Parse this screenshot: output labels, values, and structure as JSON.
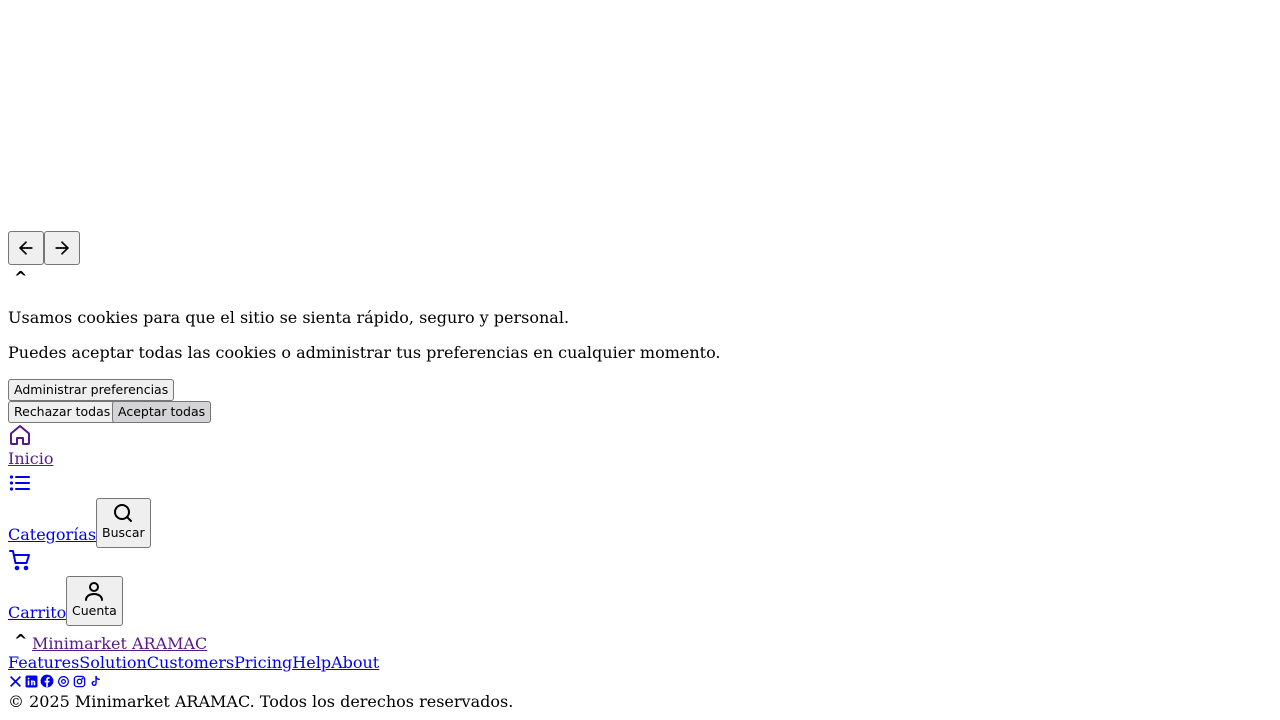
{
  "carousel": {
    "prev_icon": "arrow-left-icon",
    "next_icon": "arrow-right-icon"
  },
  "cookie_banner": {
    "toggle_glyph": "^",
    "message_1": "Usamos cookies para que el sitio se sienta rápido, seguro y personal.",
    "message_2": "Puedes aceptar todas las cookies o administrar tus preferencias en cualquier momento.",
    "manage_label": "Administrar preferencias",
    "reject_label": "Rechazar todas",
    "accept_label": "Aceptar todas"
  },
  "bottom_nav": {
    "home_label": "Inicio",
    "home_icon": "home-icon",
    "categories_label": "Categorías",
    "categories_icon": "list-icon",
    "search_label": "Buscar",
    "search_icon": "search-icon",
    "cart_label": "Carrito",
    "cart_icon": "cart-icon",
    "account_label": "Cuenta",
    "account_icon": "user-icon"
  },
  "footer": {
    "toggle_glyph": "^",
    "brand": "Minimarket ARAMAC",
    "links": [
      "Features",
      "Solution",
      "Customers",
      "Pricing",
      "Help",
      "About"
    ],
    "social_icons": [
      "x-icon",
      "linkedin-icon",
      "facebook-icon",
      "threads-icon",
      "instagram-icon",
      "tiktok-icon"
    ],
    "copyright": "© 2025 Minimarket ARAMAC. Todos los derechos reservados."
  },
  "colors": {
    "visited_link": "#551a8b",
    "link": "#0000ee",
    "button_bg": "#efeff0",
    "primary_button_bg": "#d4d4d8"
  }
}
